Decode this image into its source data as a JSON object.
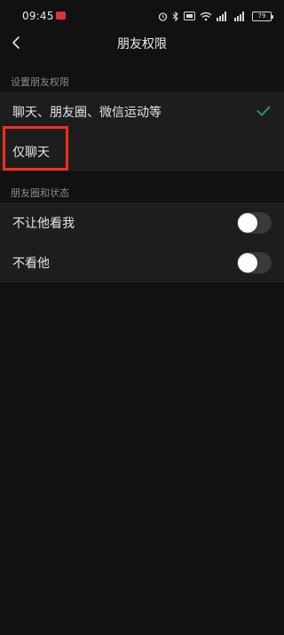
{
  "status_bar": {
    "time": "09:45",
    "battery": "79",
    "icons": [
      "notification-badge",
      "alarm-icon",
      "bluetooth-icon",
      "hd-icon",
      "wifi-icon",
      "signal-icon",
      "signal-icon",
      "battery-icon"
    ]
  },
  "nav": {
    "title": "朋友权限",
    "back_icon": "chevron-left-icon"
  },
  "sections": {
    "permission": {
      "header": "设置朋友权限",
      "options": [
        {
          "label": "聊天、朋友圈、微信运动等",
          "selected": true
        },
        {
          "label": "仅聊天",
          "selected": false
        }
      ]
    },
    "moments": {
      "header": "朋友圈和状态",
      "toggles": [
        {
          "label": "不让他看我",
          "on": false
        },
        {
          "label": "不看他",
          "on": false
        }
      ]
    }
  },
  "colors": {
    "background": "#111111",
    "row_background": "#1d1d1d",
    "check": "#2ea05c",
    "highlight": "#ff2d1a",
    "toggle_off": "#3a3a3a"
  }
}
